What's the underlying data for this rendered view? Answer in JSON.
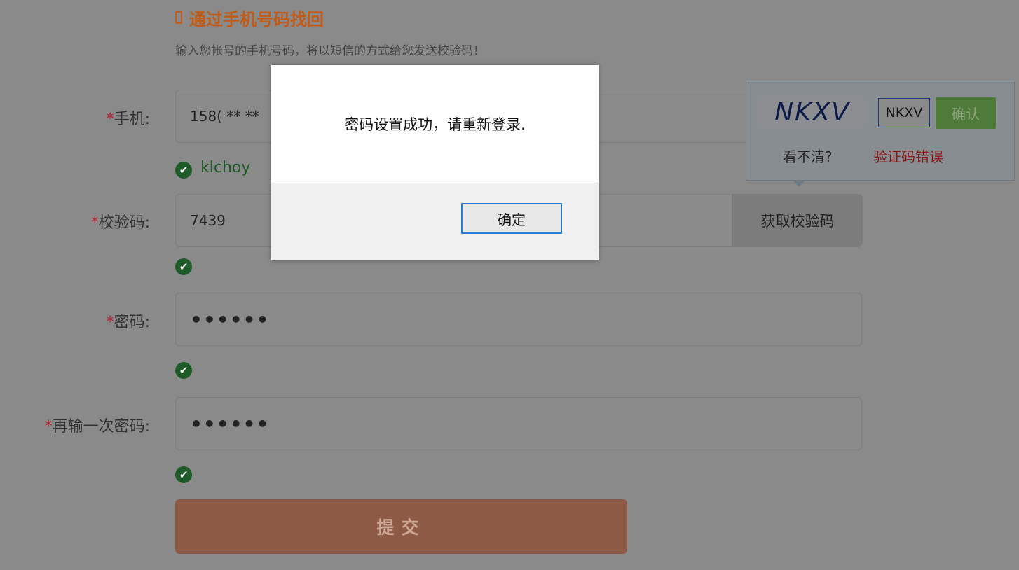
{
  "header": {
    "title": "通过手机号码找回",
    "subtitle": "输入您帐号的手机号码，将以短信的方式给您发送校验码！"
  },
  "form": {
    "required_mark": "*",
    "phone": {
      "label": "手机:",
      "value": "158( ** **",
      "status": "klchoy"
    },
    "code": {
      "label": "校验码:",
      "value": "7439",
      "button": "获取校验码"
    },
    "password": {
      "label": "密码:",
      "value": "••••••"
    },
    "password_confirm": {
      "label": "再输一次密码:",
      "value": "••••••"
    },
    "submit": "提交"
  },
  "captcha": {
    "image_text": "NKXV",
    "input_value": "NKXV",
    "confirm_button": "确认",
    "unclear_link": "看不清?",
    "error_text": "验证码错误"
  },
  "dialog": {
    "message": "密码设置成功，请重新登录.",
    "ok_button": "确定"
  },
  "colors": {
    "title": "#c25a18",
    "success": "#1f5a29",
    "submit_bg": "#8d5a45",
    "dialog_ok_border": "#2c7cd1",
    "error": "#8a1616"
  }
}
